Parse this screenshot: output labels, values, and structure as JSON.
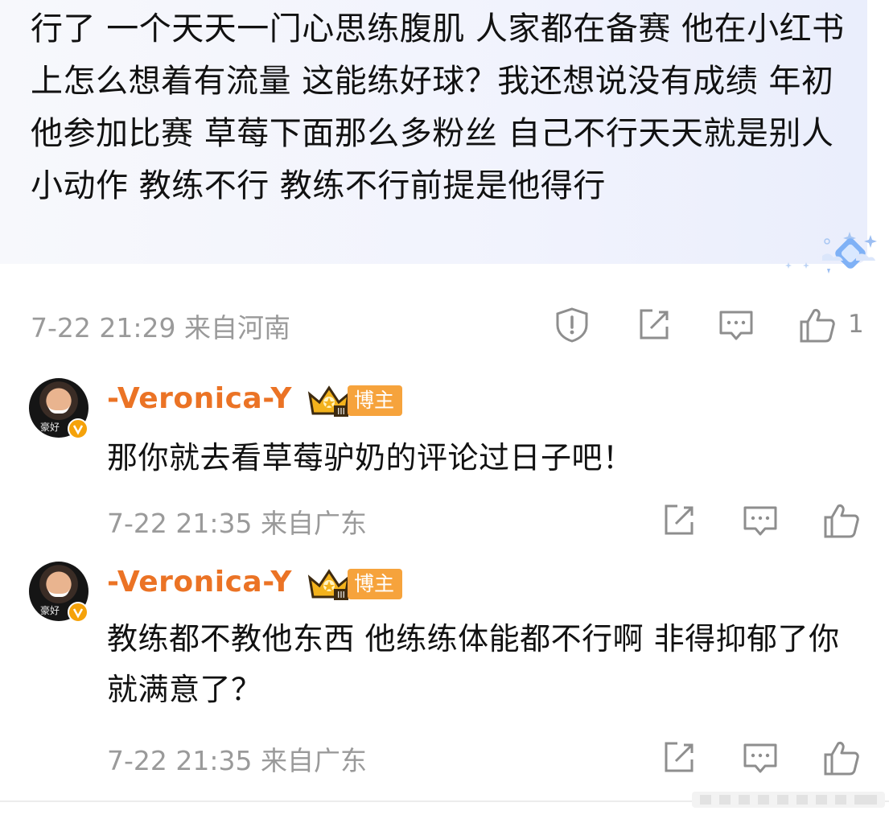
{
  "top_comment": {
    "text": "行了 一个天天一门心思练腹肌 人家都在备赛 他在小红书上怎么想着有流量 这能练好球？我还想说没有成绩 年初他参加比赛 草莓下面那么多粉丝 自己不行天天就是别人小动作 教练不行 教练不行前提是他得行",
    "meta": "7-22 21:29 来自河南",
    "like_count": "1"
  },
  "replies": [
    {
      "username": "-Veronica-Y",
      "badge": "博主",
      "avatar_watermark": "豪好",
      "text": "那你就去看草莓驴奶的评论过日子吧！",
      "meta": "7-22 21:35 来自广东"
    },
    {
      "username": "-Veronica-Y",
      "badge": "博主",
      "avatar_watermark": "豪好",
      "text": "教练都不教他东西 他练练体能都不行啊 非得抑郁了你就满意了？",
      "meta": "7-22 21:35 来自广东"
    }
  ],
  "icons": [
    "report-icon",
    "forward-icon",
    "comment-icon",
    "like-icon",
    "crown-icon",
    "verified-icon"
  ],
  "colors": {
    "username": "#eb7325",
    "badge": "#f6a33c",
    "meta": "#9a9a9a",
    "icon": "#8e8e8e"
  }
}
